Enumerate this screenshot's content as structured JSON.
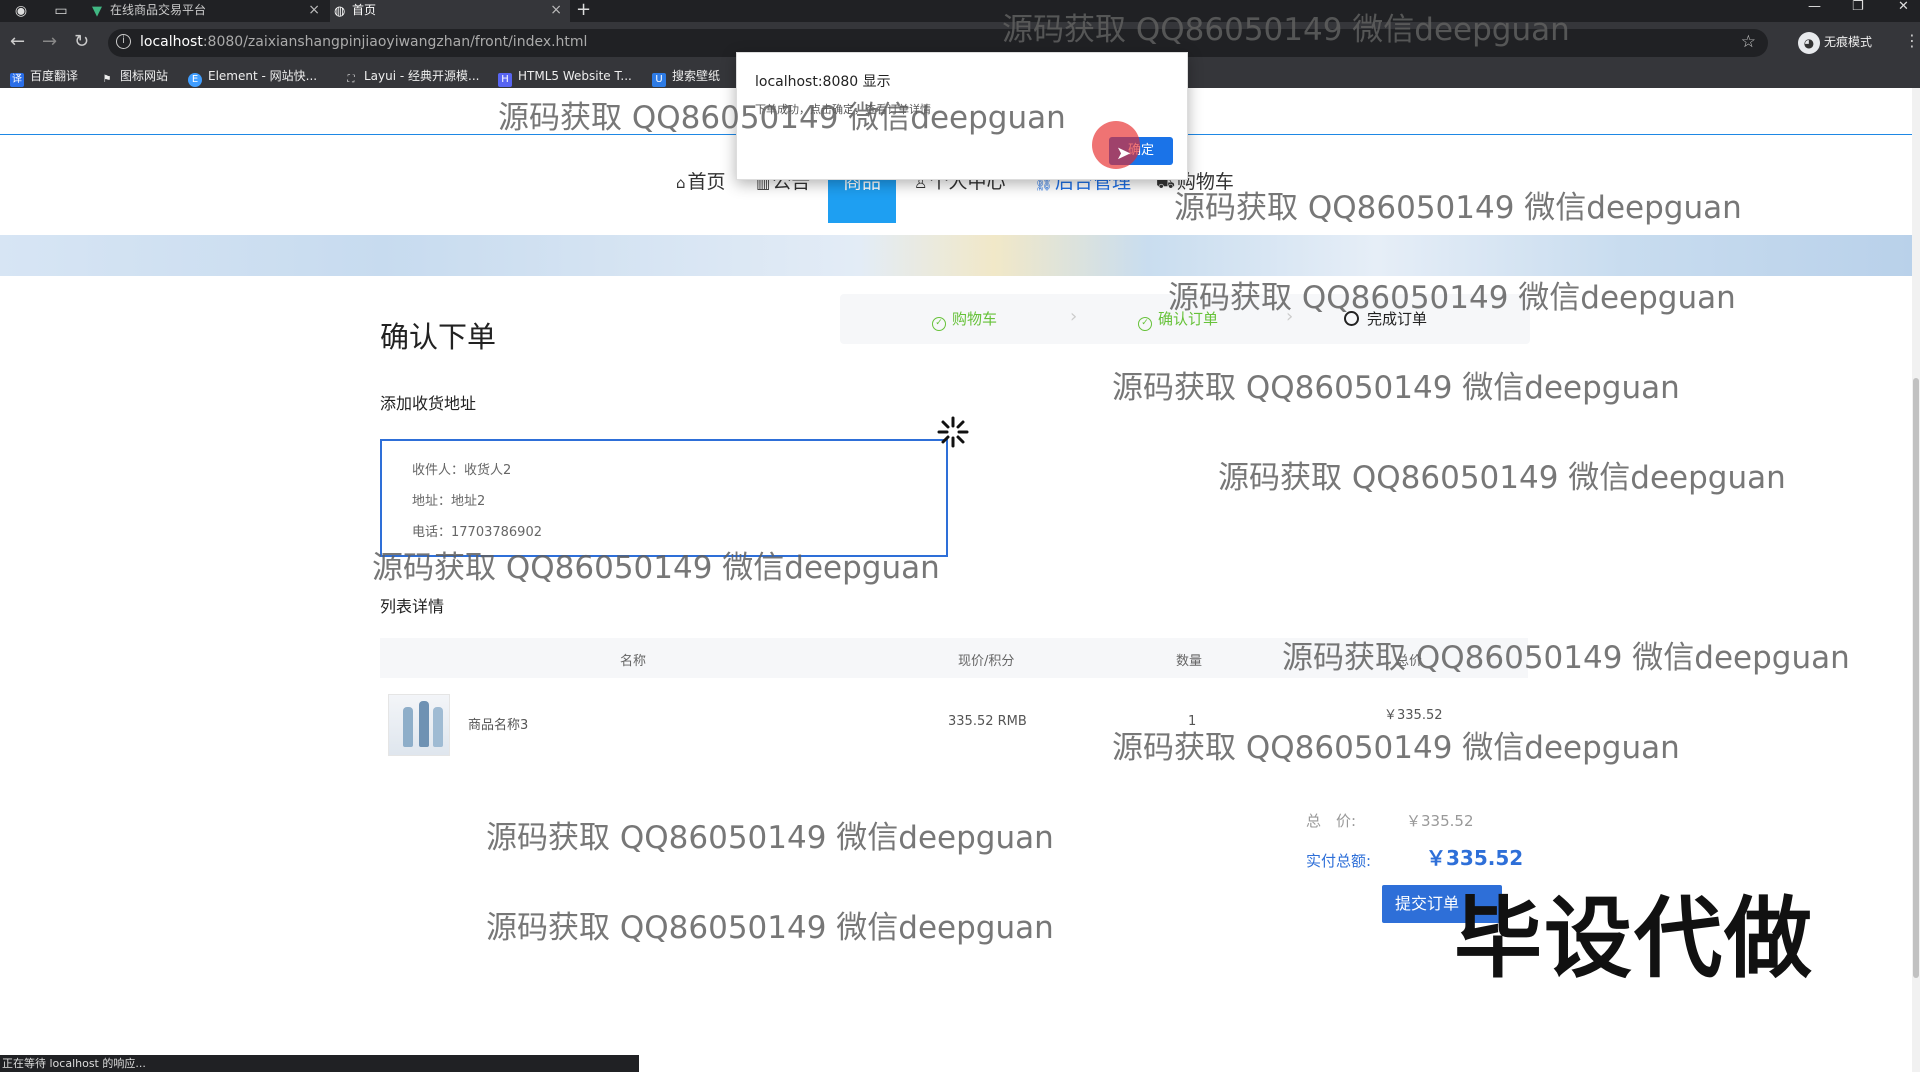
{
  "browser": {
    "tabs": [
      {
        "title": "在线商品交易平台",
        "active": false
      },
      {
        "title": "首页",
        "active": true
      }
    ],
    "url_host": "localhost",
    "url_path": ":8080/zaixianshangpinjiaoyiwangzhan/front/index.html",
    "profile_label": "无痕模式",
    "bookmarks": [
      "百度翻译",
      "图标网站",
      "Element - 网站快...",
      "Layui - 经典开源模...",
      "HTML5 Website T...",
      "搜索壁纸"
    ],
    "status_text": "正在等待 localhost 的响应..."
  },
  "nav": {
    "home": "首页",
    "notice": "公告",
    "products": "商品",
    "personal": "个人中心",
    "admin": "后台管理",
    "cart": "购物车"
  },
  "page": {
    "title": "确认下单",
    "steps": [
      {
        "label": "购物车",
        "state": "done"
      },
      {
        "label": "确认订单",
        "state": "done"
      },
      {
        "label": "完成订单",
        "state": "current"
      }
    ],
    "address_section_title": "添加收货地址",
    "address": {
      "recipient": "收件人：收货人2",
      "addr": "地址：地址2",
      "phone": "电话：17703786902"
    },
    "list_title": "列表详情",
    "table": {
      "headers": {
        "name": "名称",
        "price": "现价/积分",
        "qty": "数量",
        "total": "总价"
      },
      "rows": [
        {
          "name": "商品名称3",
          "price": "335.52 RMB",
          "qty": "1",
          "total": "￥335.52"
        }
      ]
    },
    "summary": {
      "total_label": "总　价:",
      "total_value": "￥335.52",
      "paid_label": "实付总额:",
      "paid_value": "￥335.52",
      "submit_label": "提交订单"
    }
  },
  "dialog": {
    "title": "localhost:8080 显示",
    "message": "下单成功，点击确定，查看订单详情",
    "ok_label": "确定"
  },
  "watermark": "源码获取 QQ86050149 微信deepguan",
  "stamp": "毕设代做",
  "colors": {
    "accent": "#1e9ff2",
    "primary": "#2e6fd8",
    "success": "#67c23a"
  }
}
